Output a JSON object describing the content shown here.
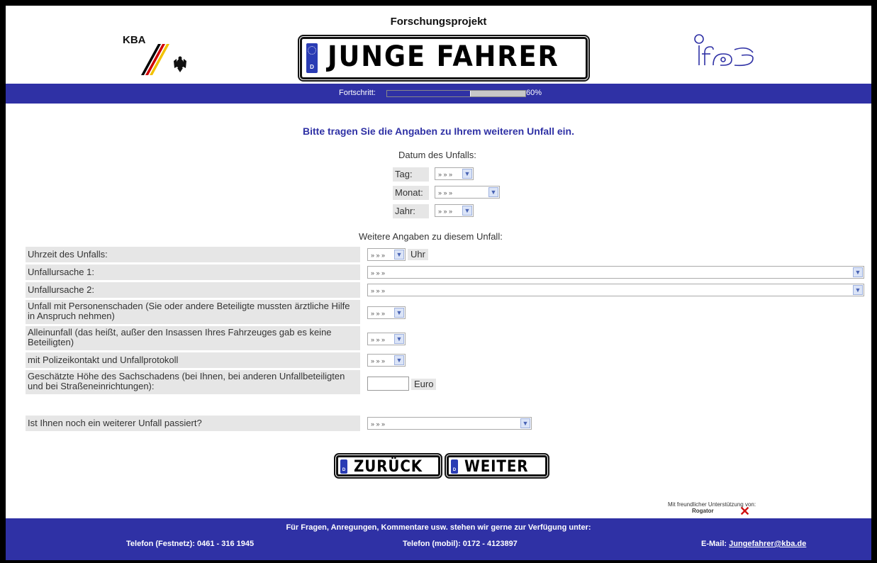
{
  "header": {
    "title": "Forschungsprojekt",
    "kba_label": "KBA",
    "plate_country": "D",
    "plate_text": "JUNGE FAHRER"
  },
  "progress": {
    "label": "Fortschritt:",
    "value_text": "60%",
    "fraction": 0.6
  },
  "main": {
    "heading": "Bitte tragen Sie die Angaben zu Ihrem weiteren Unfall ein."
  },
  "date": {
    "title": "Datum des Unfalls:",
    "day_label": "Tag:",
    "day_value": "» » »",
    "month_label": "Monat:",
    "month_value": "» » »",
    "year_label": "Jahr:",
    "year_value": "» » »"
  },
  "details": {
    "title": "Weitere Angaben zu diesem Unfall:",
    "time_label": "Uhrzeit des Unfalls:",
    "time_value": "» » »",
    "time_unit": "Uhr",
    "cause1_label": "Unfallursache 1:",
    "cause1_value": "» » »",
    "cause2_label": "Unfallursache 2:",
    "cause2_value": "» » »",
    "injury_label": "Unfall mit Personenschaden (Sie oder andere Beteiligte mussten ärztliche Hilfe in Anspruch nehmen)",
    "injury_value": "» » »",
    "alone_label": "Alleinunfall (das heißt, außer den Insassen Ihres Fahrzeuges gab es keine Beteiligten)",
    "alone_value": "» » »",
    "police_label": "mit Polizeikontakt und Unfallprotokoll",
    "police_value": "» » »",
    "damage_label": "Geschätzte Höhe des Sachschadens (bei Ihnen, bei anderen Unfallbeteiligten und bei Straßeneinrichtungen):",
    "damage_value": "",
    "damage_unit": "Euro",
    "another_label": "Ist Ihnen noch ein weiterer Unfall passiert?",
    "another_value": "» » »"
  },
  "nav": {
    "back_label": "ZURÜCK",
    "next_label": "WEITER",
    "plate_country": "D"
  },
  "sponsor": {
    "text": "Mit freundlicher Unterstützung von:",
    "name": "Rogator"
  },
  "footer": {
    "main": "Für Fragen, Anregungen, Kommentare usw. stehen wir gerne zur Verfügung unter:",
    "tel_fixed": "Telefon (Festnetz): 0461 - 316 1945",
    "tel_mobile": "Telefon (mobil): 0172 - 4123897",
    "email_label": "E-Mail:",
    "email": "Jungefahrer@kba.de"
  },
  "colors": {
    "brand_blue": "#2f31a5",
    "label_bg": "#e6e6e6",
    "rogator_red": "#d01010"
  }
}
